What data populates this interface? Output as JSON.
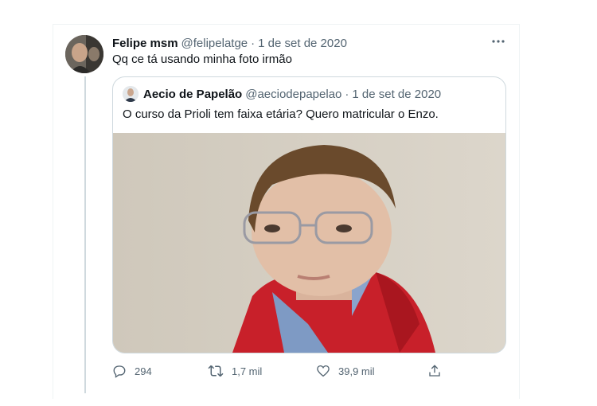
{
  "tweet": {
    "author_name": "Felipe msm",
    "author_handle": "@felipelatge",
    "separator": "·",
    "date": "1 de set de 2020",
    "text": "Qq ce tá usando minha foto irmão",
    "more_icon": "ellipsis-icon"
  },
  "quoted": {
    "author_name": "Aecio de Papelão",
    "author_handle": "@aeciodepapelao",
    "separator": "·",
    "date": "1 de set de 2020",
    "text": "O curso da Prioli tem faixa etária? Quero matricular o Enzo."
  },
  "actions": {
    "reply": {
      "icon": "reply-icon",
      "count": "294"
    },
    "retweet": {
      "icon": "retweet-icon",
      "count": "1,7 mil"
    },
    "like": {
      "icon": "heart-icon",
      "count": "39,9 mil"
    },
    "share": {
      "icon": "share-icon"
    }
  },
  "colors": {
    "text": "#0f1419",
    "secondary": "#536471",
    "border": "#cfd9de",
    "hoodie": "#c8202a"
  }
}
